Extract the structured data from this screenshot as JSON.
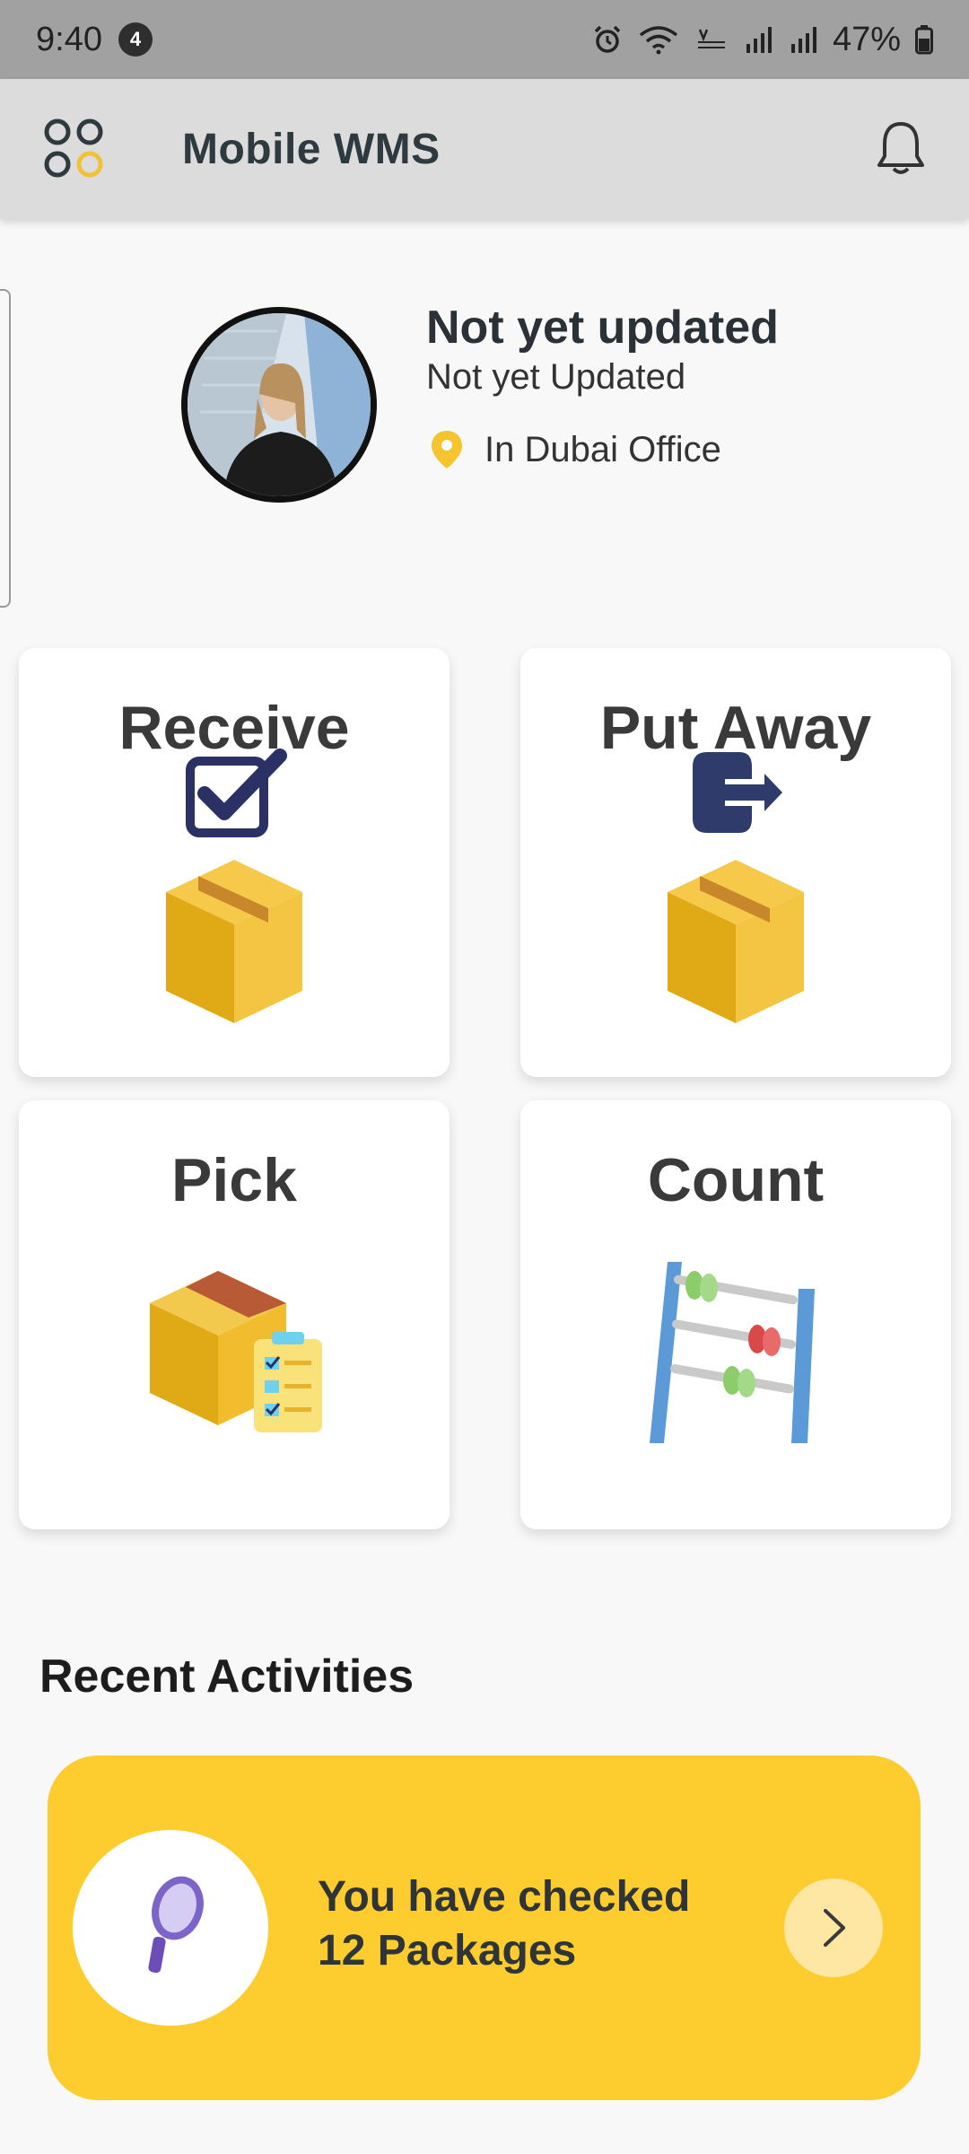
{
  "status_bar": {
    "time": "9:40",
    "notification_count": "4",
    "battery": "47%"
  },
  "app_bar": {
    "title": "Mobile WMS"
  },
  "profile": {
    "name": "Not yet updated",
    "subtitle": "Not yet Updated",
    "location": "In Dubai Office"
  },
  "actions": [
    {
      "label": "Receive"
    },
    {
      "label": "Put Away"
    },
    {
      "label": "Pick"
    },
    {
      "label": "Count"
    }
  ],
  "recent": {
    "title": "Recent Activities",
    "line1": "You have checked",
    "line2": "12 Packages"
  },
  "colors": {
    "accent": "#fdcc2f",
    "navy": "#2b3164",
    "box": "#f2c13a"
  }
}
